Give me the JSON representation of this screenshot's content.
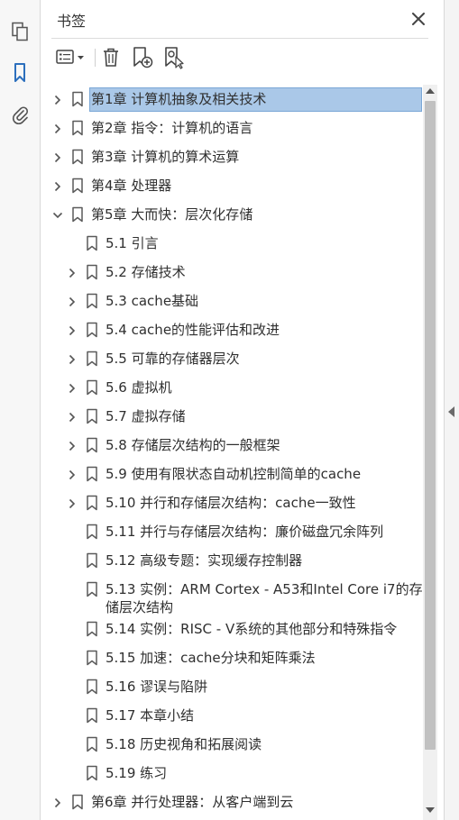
{
  "panel": {
    "title": "书签",
    "close_icon": "close-icon"
  },
  "leftbar": {
    "items": [
      {
        "icon": "pages-icon",
        "active": false
      },
      {
        "icon": "bookmark-icon",
        "active": true
      },
      {
        "icon": "attachment-icon",
        "active": false
      }
    ]
  },
  "toolbar": {
    "buttons": [
      "options-menu-icon",
      "delete-icon",
      "new-bookmark-icon",
      "new-bookmark-from-structure-icon"
    ]
  },
  "colors": {
    "accent": "#2c6fbd",
    "selected_bg": "#aac8e8",
    "selected_border": "#7aa7d6"
  },
  "bookmarks": [
    {
      "label": "第1章 计算机抽象及相关技术",
      "level": 0,
      "expand": "collapsed",
      "selected": true
    },
    {
      "label": "第2章 指令：计算机的语言",
      "level": 0,
      "expand": "collapsed"
    },
    {
      "label": "第3章 计算机的算术运算",
      "level": 0,
      "expand": "collapsed"
    },
    {
      "label": "第4章 处理器",
      "level": 0,
      "expand": "collapsed"
    },
    {
      "label": "第5章 大而快：层次化存储",
      "level": 0,
      "expand": "expanded"
    },
    {
      "label": "5.1 引言",
      "level": 1,
      "expand": "none"
    },
    {
      "label": "5.2 存储技术",
      "level": 1,
      "expand": "collapsed"
    },
    {
      "label": "5.3 cache基础",
      "level": 1,
      "expand": "collapsed"
    },
    {
      "label": "5.4 cache的性能评估和改进",
      "level": 1,
      "expand": "collapsed"
    },
    {
      "label": "5.5 可靠的存储器层次",
      "level": 1,
      "expand": "collapsed"
    },
    {
      "label": "5.6 虚拟机",
      "level": 1,
      "expand": "collapsed"
    },
    {
      "label": "5.7 虚拟存储",
      "level": 1,
      "expand": "collapsed"
    },
    {
      "label": "5.8 存储层次结构的一般框架",
      "level": 1,
      "expand": "collapsed"
    },
    {
      "label": "5.9 使用有限状态自动机控制简单的cache",
      "level": 1,
      "expand": "collapsed"
    },
    {
      "label": "5.10 并行和存储层次结构：cache一致性",
      "level": 1,
      "expand": "collapsed"
    },
    {
      "label": "5.11 并行与存储层次结构：廉价磁盘冗余阵列",
      "level": 1,
      "expand": "none"
    },
    {
      "label": "5.12 高级专题：实现缓存控制器",
      "level": 1,
      "expand": "none"
    },
    {
      "label": "5.13 实例：ARM Cortex - A53和Intel Core i7的存储层次结构",
      "level": 1,
      "expand": "none",
      "wrap": true
    },
    {
      "label": "5.14 实例：RISC - V系统的其他部分和特殊指令",
      "level": 1,
      "expand": "none"
    },
    {
      "label": "5.15 加速：cache分块和矩阵乘法",
      "level": 1,
      "expand": "none"
    },
    {
      "label": "5.16 谬误与陷阱",
      "level": 1,
      "expand": "none"
    },
    {
      "label": "5.17 本章小结",
      "level": 1,
      "expand": "none"
    },
    {
      "label": "5.18 历史视角和拓展阅读",
      "level": 1,
      "expand": "none"
    },
    {
      "label": "5.19 练习",
      "level": 1,
      "expand": "none"
    },
    {
      "label": "第6章 并行处理器：从客户端到云",
      "level": 0,
      "expand": "collapsed"
    }
  ]
}
